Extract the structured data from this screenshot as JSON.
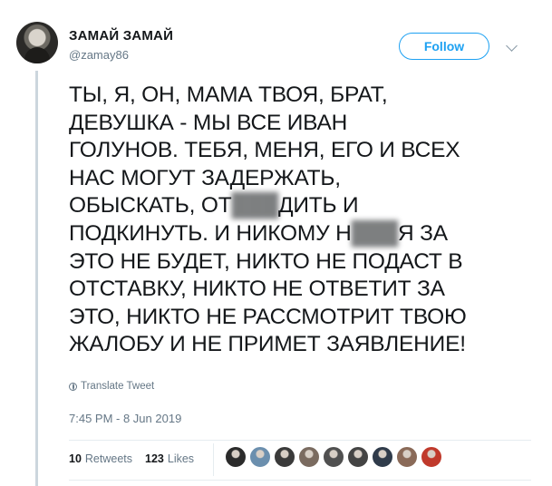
{
  "author": {
    "name": "ЗАМАЙ ЗАМАЙ",
    "handle": "@zamay86"
  },
  "follow_label": "Follow",
  "tweet_lines": [
    "ТЫ, Я, ОН, МАМА ТВОЯ, БРАТ,",
    "ДЕВУШКА - МЫ ВСЕ ИВАН",
    "ГОЛУНОВ. ТЕБЯ, МЕНЯ, ЕГО И ВСЕХ",
    "НАС МОГУТ ЗАДЕРЖАТЬ,",
    "ОБЫСКАТЬ, ОТ",
    "ПОДКИНУТЬ. И НИКОМУ Н",
    "ЭТО НЕ БУДЕТ, НИКТО НЕ ПОДАСТ В",
    "ОТСТАВКУ, НИКТО НЕ ОТВЕТИТ ЗА",
    "ЭТО, НИКТО НЕ РАССМОТРИТ ТВОЮ",
    "ЖАЛОБУ И НЕ ПРИМЕТ ЗАЯВЛЕНИЕ!"
  ],
  "line5_tail": "ДИТЬ И",
  "line6_tail": "Я ЗА",
  "translate_label": "Translate Tweet",
  "timestamp": "7:45 PM - 8 Jun 2019",
  "retweets": {
    "count": "10",
    "label": "Retweets"
  },
  "likes": {
    "count": "123",
    "label": "Likes"
  },
  "liker_colors": [
    "#2b2b2b",
    "#6b8fae",
    "#3a3a3a",
    "#7a6b60",
    "#505050",
    "#444444",
    "#2f3b4a",
    "#8a6a58",
    "#c0392b"
  ],
  "accent_color": "#1da1f2"
}
